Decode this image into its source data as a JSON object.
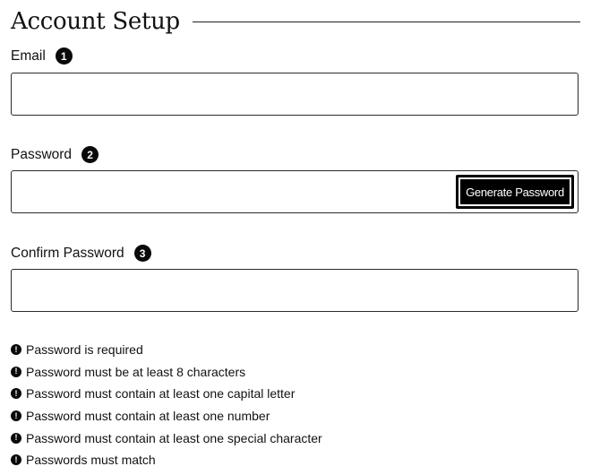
{
  "header": {
    "title": "Account Setup"
  },
  "fields": [
    {
      "label": "Email",
      "step": "1",
      "value": ""
    },
    {
      "label": "Password",
      "step": "2",
      "value": "",
      "button_label": "Generate Password"
    },
    {
      "label": "Confirm Password",
      "step": "3",
      "value": ""
    }
  ],
  "errors": {
    "icon": "exclamation-circle-icon",
    "items": [
      "Password is required",
      "Password must be at least 8 characters",
      "Password must contain at least one capital letter",
      "Password must contain at least one number",
      "Password must contain at least one special character",
      "Passwords must match"
    ]
  },
  "colors": {
    "text": "#111111",
    "border": "#2b2b2b",
    "button_bg": "#000000",
    "button_text": "#ffffff"
  }
}
